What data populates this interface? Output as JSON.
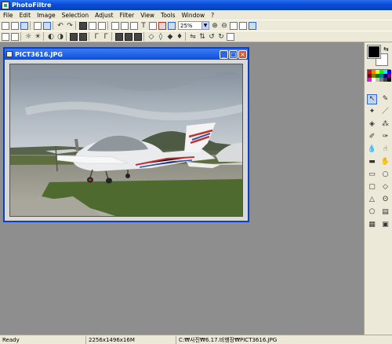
{
  "app": {
    "title": "PhotoFiltre"
  },
  "menu": [
    "File",
    "Edit",
    "Image",
    "Selection",
    "Adjust",
    "Filter",
    "View",
    "Tools",
    "Window",
    "?"
  ],
  "toolbar": {
    "zoom_value": "25%"
  },
  "document": {
    "title": "PICT3616.JPG"
  },
  "status": {
    "state": "Ready",
    "image_info": "2256x1496x16M",
    "file_path": "C:₩사진₩6.17.비행장₩PICT3616.JPG"
  },
  "palette_colors": [
    "#ff0000",
    "#ff8000",
    "#ffff00",
    "#00ff00",
    "#00ffff",
    "#0000ff",
    "#800000",
    "#808000",
    "#008000",
    "#008080",
    "#000080",
    "#800080",
    "#ff00ff",
    "#ffffff",
    "#c0c0c0",
    "#808080",
    "#404040",
    "#000000"
  ],
  "colors": {
    "foreground": "#000000",
    "background": "#ffffff"
  }
}
